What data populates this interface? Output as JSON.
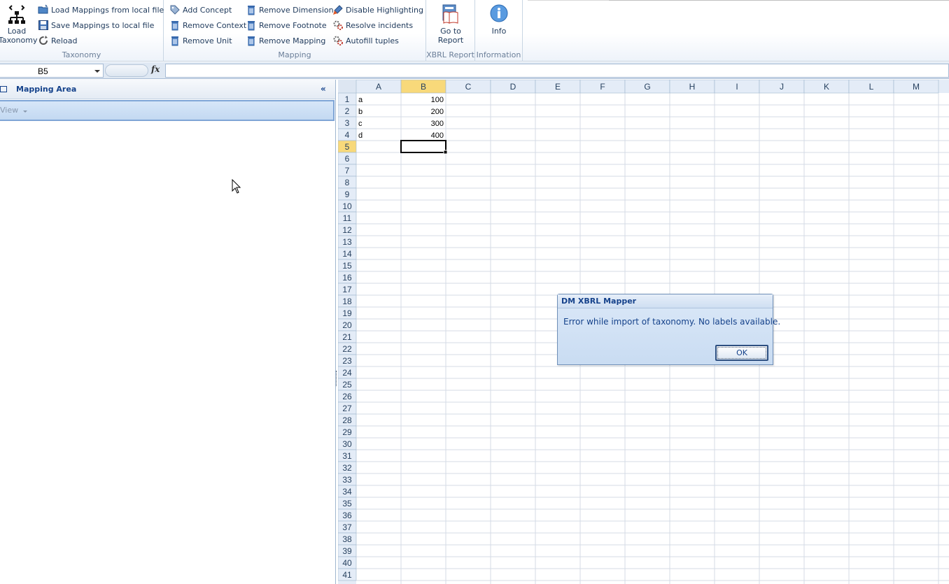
{
  "ribbon": {
    "taxonomy": {
      "label": "Taxonomy",
      "load_taxonomy": "Load Taxonomy",
      "load_mappings": "Load Mappings from local file",
      "save_mappings": "Save Mappings to local file",
      "reload": "Reload"
    },
    "mapping": {
      "label": "Mapping",
      "add_concept": "Add Concept",
      "remove_context": "Remove Context",
      "remove_unit": "Remove Unit",
      "remove_dimension": "Remove Dimension",
      "remove_footnote": "Remove Footnote",
      "remove_mapping": "Remove Mapping",
      "disable_highlighting": "Disable Highlighting",
      "resolve_incidents": "Resolve incidents",
      "autofill_tuples": "Autofill tuples"
    },
    "xbrl_report": {
      "label": "XBRL Report",
      "go_to_report": "Go to Report"
    },
    "information": {
      "label": "Information",
      "info": "Info"
    }
  },
  "formula_bar": {
    "name_box": "B5",
    "fx": "fx",
    "formula": ""
  },
  "pane": {
    "title": "Mapping Area",
    "view_menu": "View",
    "collapse": "«"
  },
  "sheet": {
    "columns": [
      "A",
      "B",
      "C",
      "D",
      "E",
      "F",
      "G",
      "H",
      "I",
      "J",
      "K",
      "L",
      "M"
    ],
    "row_count": 41,
    "selected_cell": "B5",
    "cells": [
      {
        "row": 1,
        "col": "A",
        "value": "a"
      },
      {
        "row": 1,
        "col": "B",
        "value": "100"
      },
      {
        "row": 2,
        "col": "A",
        "value": "b"
      },
      {
        "row": 2,
        "col": "B",
        "value": "200"
      },
      {
        "row": 3,
        "col": "A",
        "value": "c"
      },
      {
        "row": 3,
        "col": "B",
        "value": "300"
      },
      {
        "row": 4,
        "col": "A",
        "value": "d"
      },
      {
        "row": 4,
        "col": "B",
        "value": "400"
      }
    ]
  },
  "dialog": {
    "title": "DM XBRL Mapper",
    "message": "Error while import of taxonomy. No labels available.",
    "ok": "OK"
  },
  "colors": {
    "header_selected": "#f8d97a",
    "gridline": "#d4dbe5",
    "ribbon_text": "#1e395b"
  }
}
